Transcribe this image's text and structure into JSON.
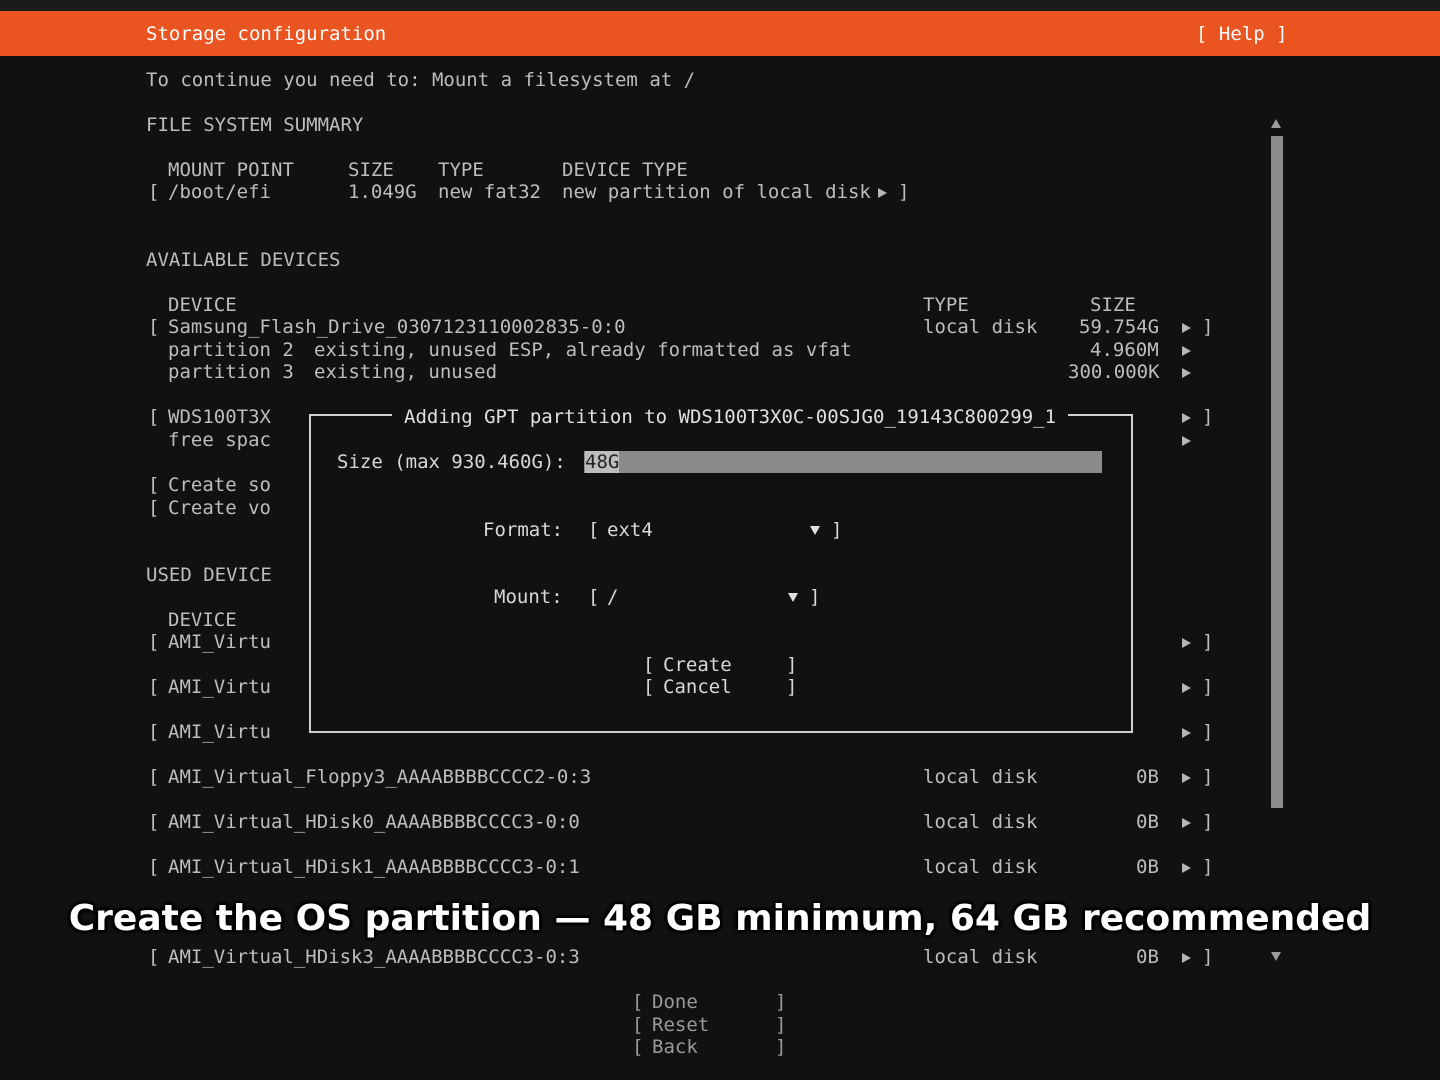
{
  "header": {
    "title": "Storage configuration",
    "help": "[ Help ]"
  },
  "instruction": "To continue you need to: Mount a filesystem at /",
  "fs_summary": {
    "heading": "FILE SYSTEM SUMMARY",
    "columns": {
      "mount": "MOUNT POINT",
      "size": "SIZE",
      "type": "TYPE",
      "device_type": "DEVICE TYPE"
    },
    "row": {
      "mount": "/boot/efi",
      "size": "1.049G",
      "type": "new fat32",
      "device_type": "new partition of local disk"
    }
  },
  "available": {
    "heading": "AVAILABLE DEVICES",
    "columns": {
      "device": "DEVICE",
      "type": "TYPE",
      "size": "SIZE"
    },
    "samsung": {
      "name": "Samsung_Flash_Drive_0307123110002835-0:0",
      "type": "local disk",
      "size": "59.754G"
    },
    "part2": {
      "name": "partition 2",
      "desc": "existing, unused ESP, already formatted as vfat",
      "size": "4.960M"
    },
    "part3": {
      "name": "partition 3",
      "desc": "existing, unused",
      "size": "300.000K"
    },
    "wds": {
      "name": "WDS100T3X"
    },
    "free": {
      "name": "free spac"
    },
    "create_sw": "Create so",
    "create_vol": "Create vo"
  },
  "used": {
    "heading": "USED DEVICE",
    "column": "DEVICE",
    "partial": [
      "AMI_Virtu",
      "AMI_Virtu",
      "AMI_Virtu"
    ],
    "rows": [
      {
        "name": "AMI_Virtual_Floppy3_AAAABBBBCCCC2-0:3",
        "type": "local disk",
        "size": "0B"
      },
      {
        "name": "AMI_Virtual_HDisk0_AAAABBBBCCCC3-0:0",
        "type": "local disk",
        "size": "0B"
      },
      {
        "name": "AMI_Virtual_HDisk1_AAAABBBBCCCC3-0:1",
        "type": "local disk",
        "size": "0B"
      },
      {
        "name": "AMI_Virtual_HDisk3_AAAABBBBCCCC3-0:3",
        "type": "local disk",
        "size": "0B"
      }
    ]
  },
  "dialog": {
    "title": "Adding GPT partition to WDS100T3X0C-00SJG0_19143C800299_1",
    "size_label": "Size (max 930.460G):",
    "size_value": "48G",
    "format_label": "Format:",
    "format_value": "ext4",
    "mount_label": "Mount:",
    "mount_value": "/",
    "create": "Create",
    "cancel": "Cancel"
  },
  "footer": {
    "done": "Done",
    "reset": "Reset",
    "back": "Back"
  },
  "overlay_caption": "Create the OS partition — 48 GB minimum, 64 GB recommended",
  "colors": {
    "accent": "#e95420",
    "background": "#111111",
    "text": "#bdbdbd"
  }
}
